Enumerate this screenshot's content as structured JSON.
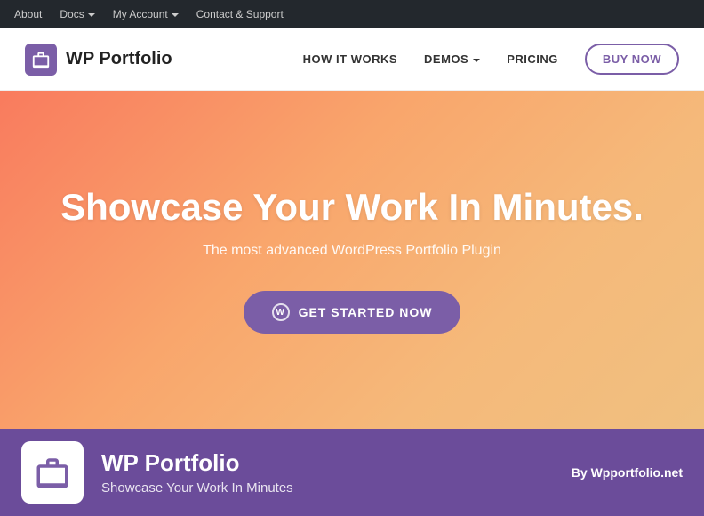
{
  "admin_bar": {
    "items": [
      {
        "label": "About",
        "has_dropdown": false
      },
      {
        "label": "Docs",
        "has_dropdown": true
      },
      {
        "label": "My Account",
        "has_dropdown": true
      },
      {
        "label": "Contact & Support",
        "has_dropdown": false
      }
    ]
  },
  "main_nav": {
    "logo_text": "WP Portfolio",
    "links": [
      {
        "label": "HOW IT WORKS",
        "has_dropdown": false
      },
      {
        "label": "DEMOS",
        "has_dropdown": true
      },
      {
        "label": "PRICING",
        "has_dropdown": false
      }
    ],
    "buy_now_label": "BUY NOW"
  },
  "hero": {
    "title": "Showcase Your Work In Minutes.",
    "subtitle": "The most advanced WordPress Portfolio Plugin",
    "cta_label": "GET STARTED NOW"
  },
  "plugin_info": {
    "name": "WP Portfolio",
    "tagline": "Showcase Your Work In Minutes",
    "author_prefix": "By ",
    "author": "Wpportfolio.net"
  }
}
